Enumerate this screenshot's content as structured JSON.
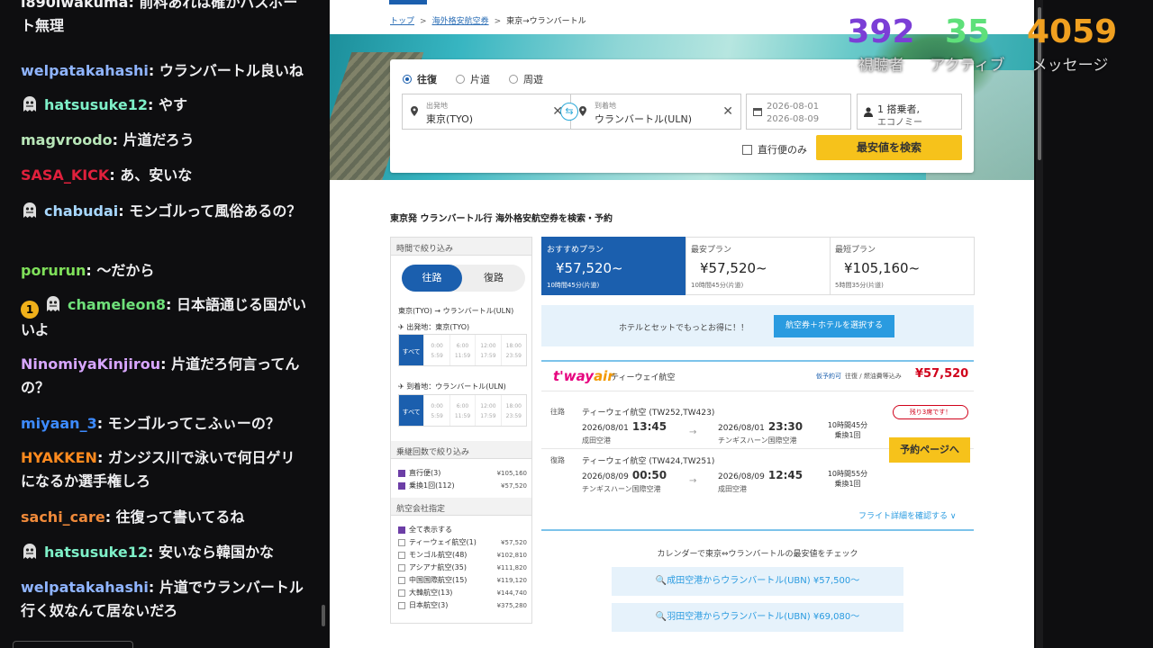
{
  "chat": {
    "messages": [
      {
        "user": "l890iwakuma",
        "text": "前科あれは確かパスポート無理",
        "color": "#efeff1",
        "icon": ""
      },
      {
        "user": "welpatakahashi",
        "text": "ウランバートル良いね",
        "color": "#8fb4ff",
        "icon": ""
      },
      {
        "user": "hatsusuke12",
        "text": "やす",
        "color": "#7ef0c8",
        "icon": "ghost-emote-icon"
      },
      {
        "user": "magvroodo",
        "text": "片道だろう",
        "color": "#b8e6b8",
        "icon": ""
      },
      {
        "user": "SASA_KICK",
        "text": "あ、安いな",
        "color": "#e0203c",
        "icon": ""
      },
      {
        "user": "chabudai",
        "text": "モンゴルって風俗あるの？",
        "color": "#a8d8ff",
        "icon": "ghost-emote-icon"
      },
      {
        "user": "porurun",
        "text": "～だから",
        "color": "#7fe05a",
        "icon": ""
      },
      {
        "user": "chameleon8",
        "text": "日本語通じる国がいいよ",
        "color": "#6fe07a",
        "icon": "ghost-emote-icon",
        "badge": "1"
      },
      {
        "user": "NinomiyaKinjirou",
        "text": "片道だろ何言ってんの？",
        "color": "#d8a6ff",
        "icon": ""
      },
      {
        "user": "miyaan_3",
        "text": "モンゴルってこふぃーの？",
        "color": "#3d8bff",
        "icon": ""
      },
      {
        "user": "HYAKKEN",
        "text": "ガンジス川で泳いで何日ゲリになるか選手権しろ",
        "color": "#ff8a1e",
        "icon": ""
      },
      {
        "user": "sachi_care",
        "text": "往復って書いてるね",
        "color": "#f08a3a",
        "icon": ""
      },
      {
        "user": "hatsusuke12",
        "text": "安いなら韓国かな",
        "color": "#7ef0c8",
        "icon": "ghost-emote-icon"
      },
      {
        "user": "welpatakahashi",
        "text": "片道でウランバートル行く奴なんて居ないだろ",
        "color": "#8fb4ff",
        "icon": ""
      }
    ]
  },
  "stats": [
    {
      "value": "392",
      "label": "視聴者",
      "color": "#7b3ed6"
    },
    {
      "value": "35",
      "label": "アクティブ",
      "color": "#5ee07a"
    },
    {
      "value": "4059",
      "label": "メッセージ",
      "color": "#f0a020"
    }
  ],
  "breadcrumb": {
    "top": "トップ",
    "overseas": "海外格安航空券",
    "current": "東京→ウランバートル"
  },
  "search": {
    "trip_types": [
      "往復",
      "片道",
      "周遊"
    ],
    "from_label": "出発地",
    "from_value": "東京(TYO)",
    "to_label": "到着地",
    "to_value": "ウランバートル(ULN)",
    "date_out": "2026-08-01",
    "date_in": "2026-08-09",
    "pax_line1": "1 搭乗者,",
    "pax_line2": "エコノミー",
    "direct_label": "直行便のみ",
    "button": "最安値を検索"
  },
  "page_heading": "東京発 ウランバートル行 海外格安航空券を検索・予約",
  "filters": {
    "time_head": "時間で絞り込み",
    "toggle_out": "往路",
    "toggle_ret": "復路",
    "route_out": "東京(TYO) → ウランバートル(ULN)",
    "dep_label": "出発地：東京(TYO)",
    "arr_label": "到着地：ウランバートル(ULN)",
    "time_all": "すべて",
    "time_slots": [
      "0:00 5:59",
      "6:00 11:59",
      "12:00 17:59",
      "18:00 23:59"
    ],
    "stops_head": "乗継回数で絞り込み",
    "stops": [
      {
        "label": "直行便(3)",
        "price": "¥105,160"
      },
      {
        "label": "乗換1回(112)",
        "price": "¥57,520"
      }
    ],
    "airline_head": "航空会社指定",
    "airlines": [
      {
        "label": "全て表示する",
        "price": "",
        "checked": true
      },
      {
        "label": "ティーウェイ航空(1)",
        "price": "¥57,520",
        "checked": false
      },
      {
        "label": "モンゴル航空(48)",
        "price": "¥102,810",
        "checked": false
      },
      {
        "label": "アシアナ航空(35)",
        "price": "¥111,820",
        "checked": false
      },
      {
        "label": "中国国際航空(15)",
        "price": "¥119,120",
        "checked": false
      },
      {
        "label": "大韓航空(13)",
        "price": "¥144,740",
        "checked": false
      },
      {
        "label": "日本航空(3)",
        "price": "¥375,280",
        "checked": false
      }
    ]
  },
  "plans": [
    {
      "label": "おすすめプラン",
      "price": "¥57,520~",
      "dur": "10時間45分(片道)"
    },
    {
      "label": "最安プラン",
      "price": "¥57,520~",
      "dur": "10時間45分(片道)"
    },
    {
      "label": "最短プラン",
      "price": "¥105,160~",
      "dur": "5時間35分(片道)"
    }
  ],
  "hotel": {
    "text": "ホテルとセットでもっとお得に！！",
    "button": "航空券＋ホテルを選択する"
  },
  "result": {
    "logo_main": "t'way",
    "logo_sub": "air",
    "airline": "ティーウェイ航空",
    "fare_note_blue": "仮予約可",
    "fare_note": "往復 / 燃油費等込み",
    "price": "¥57,520",
    "seats": "残り3席です！",
    "book": "予約ページへ",
    "detail": "フライト詳細を確認する ∨",
    "legs": [
      {
        "label": "往路",
        "flight": "ティーウェイ航空 (TW252,TW423)",
        "dep_date": "2026/08/01",
        "dep_time": "13:45",
        "dep_ap": "成田空港",
        "arr_date": "2026/08/01",
        "arr_time": "23:30",
        "arr_ap": "チンギスハーン国際空港",
        "dur": "10時間45分",
        "stops": "乗換1回"
      },
      {
        "label": "復路",
        "flight": "ティーウェイ航空 (TW424,TW251)",
        "dep_date": "2026/08/09",
        "dep_time": "00:50",
        "dep_ap": "チンギスハーン国際空港",
        "arr_date": "2026/08/09",
        "arr_time": "12:45",
        "arr_ap": "成田空港",
        "dur": "10時間55分",
        "stops": "乗換1回"
      }
    ]
  },
  "calendar": {
    "title": "カレンダーで東京⇔ウランバートルの最安値をチェック",
    "buttons": [
      "🔍成田空港からウランバートル(UBN) ¥57,500～",
      "🔍羽田空港からウランバートル(UBN) ¥69,080～"
    ]
  }
}
